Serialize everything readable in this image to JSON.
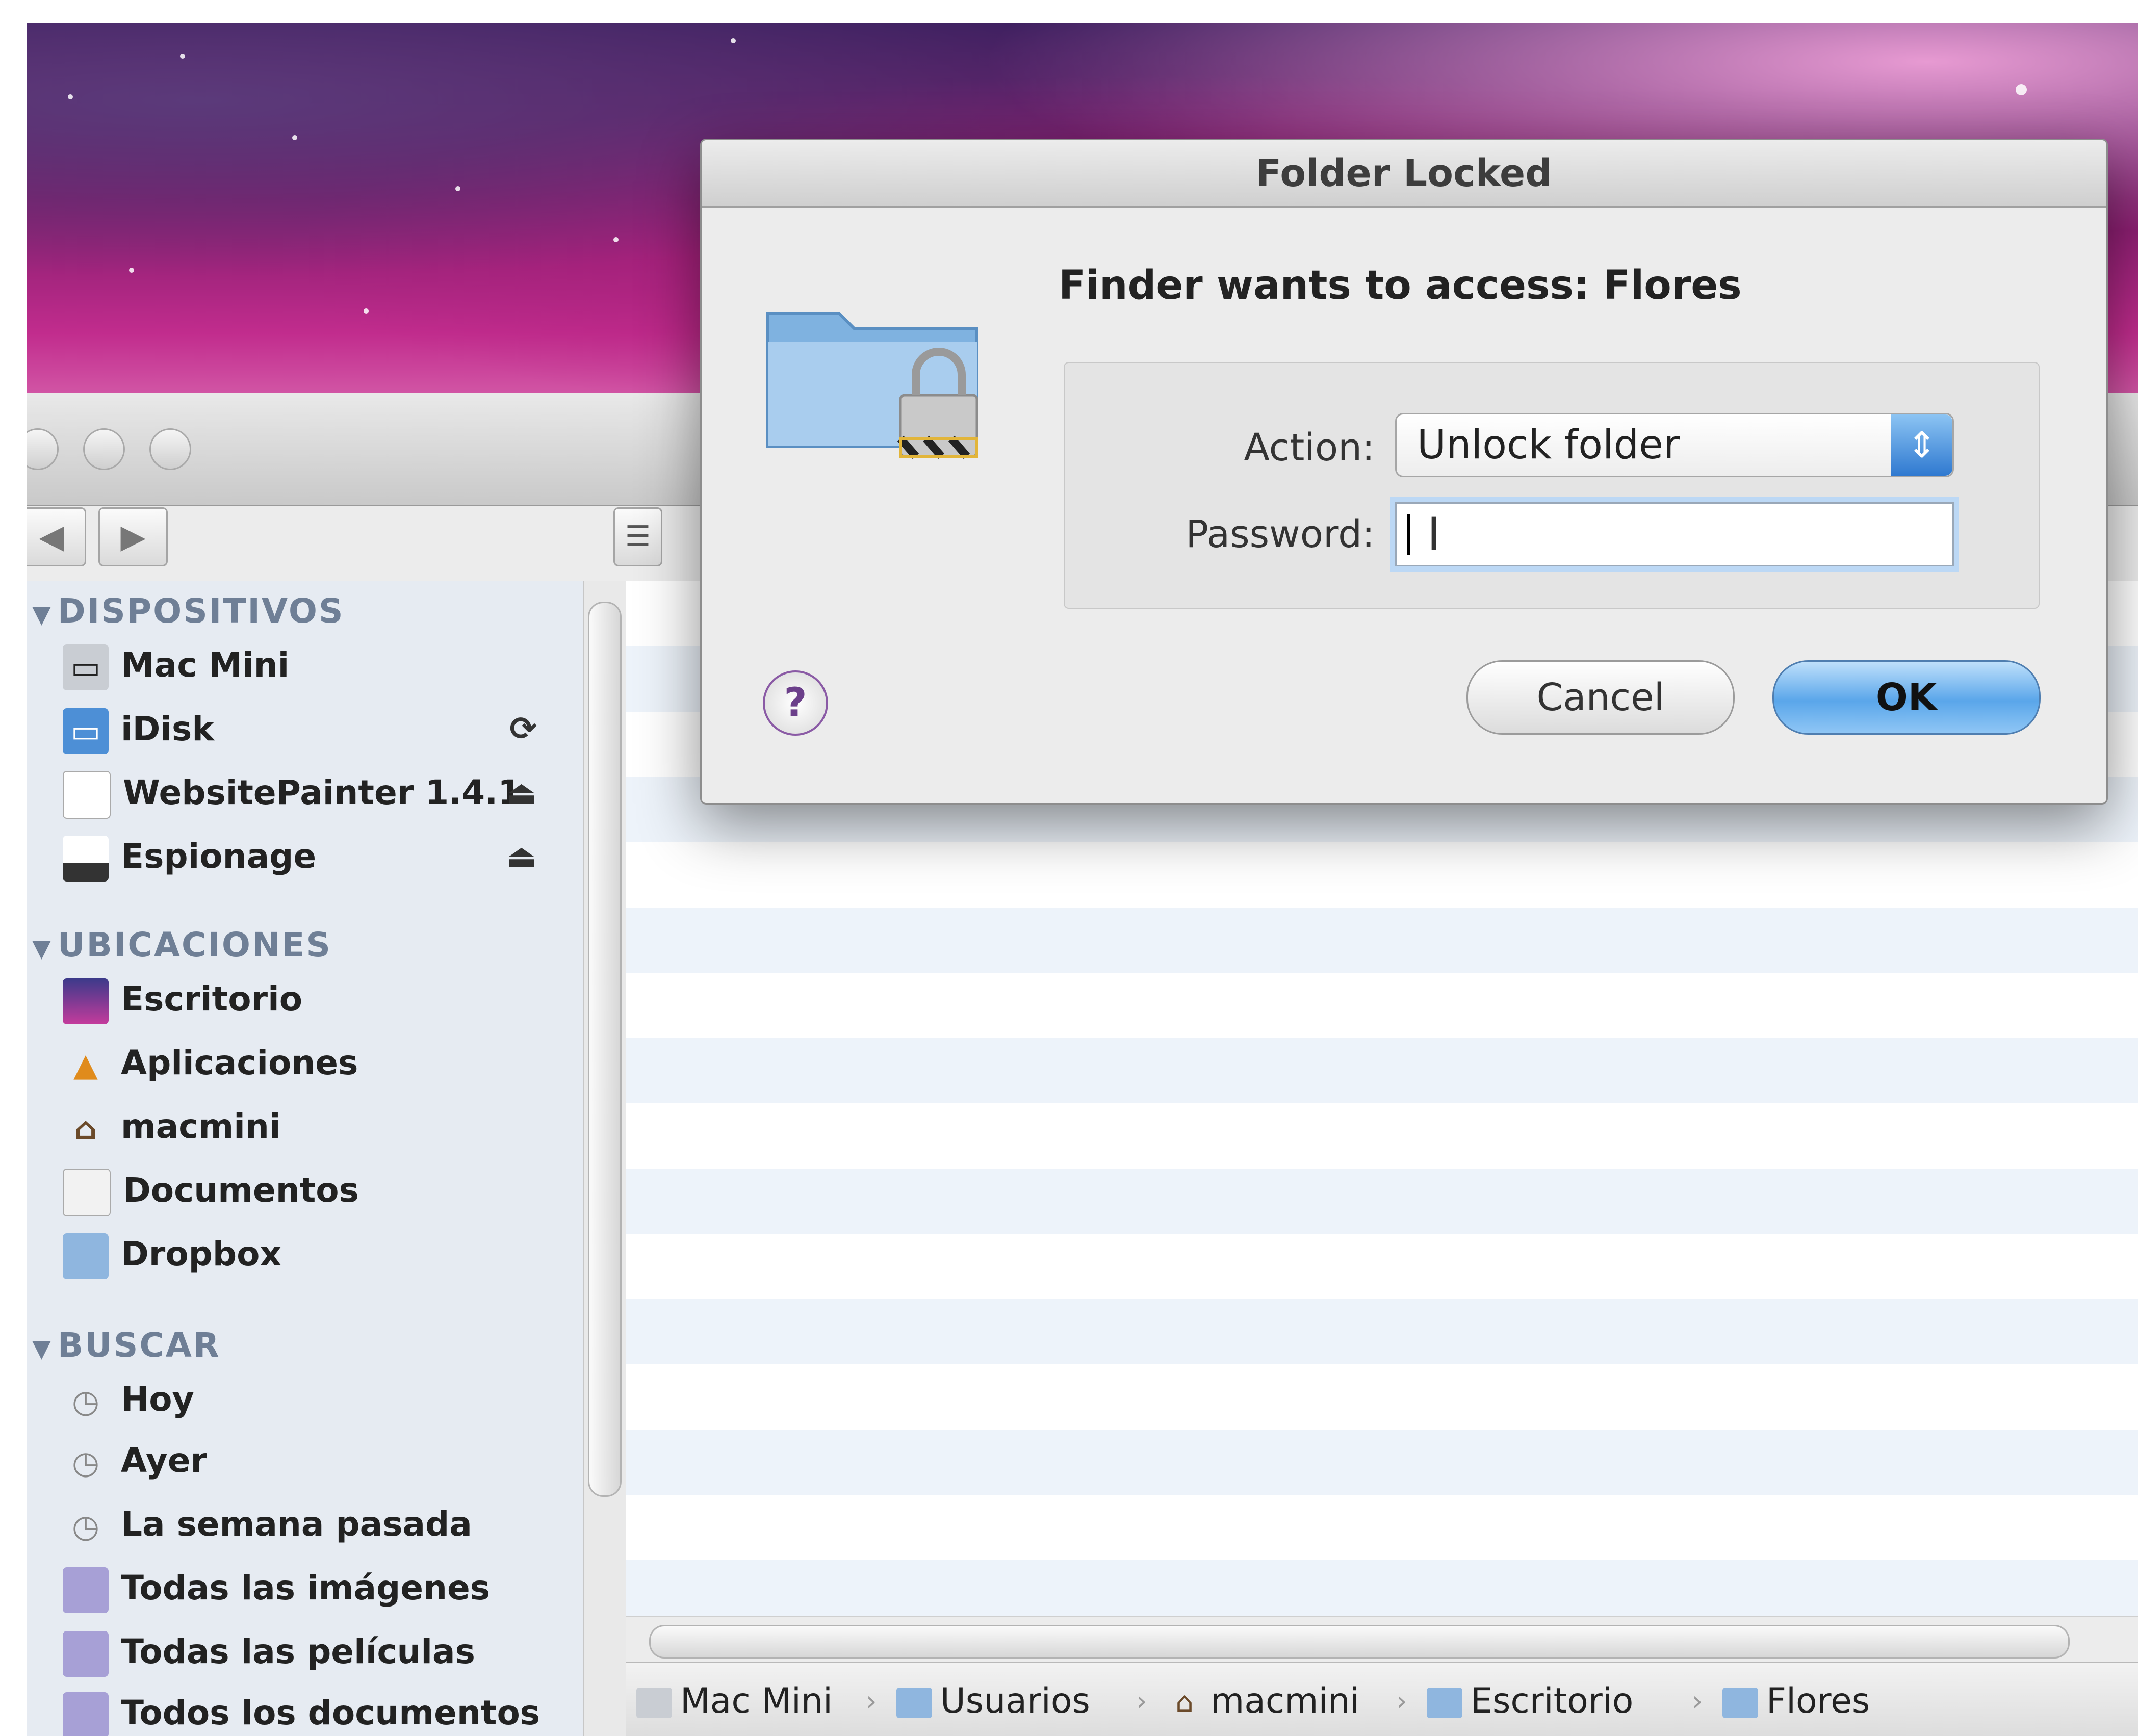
{
  "dialog": {
    "title": "Folder Locked",
    "heading": "Finder wants to access: Flores",
    "action_label": "Action:",
    "action_value": "Unlock folder",
    "password_label": "Password:",
    "password_value": "",
    "help_label": "?",
    "cancel_label": "Cancel",
    "ok_label": "OK",
    "icon": "locked-folder-icon"
  },
  "finder": {
    "nav": {
      "back_icon": "◀",
      "forward_icon": "▶"
    },
    "sidebar": {
      "sections": [
        {
          "title": "DISPOSITIVOS",
          "items": [
            {
              "label": "Mac Mini",
              "icon": "computer-icon"
            },
            {
              "label": "iDisk",
              "icon": "idisk-icon",
              "accessory": "sync-icon"
            },
            {
              "label": "WebsitePainter 1.4.1",
              "icon": "disk-image-icon",
              "accessory": "eject-icon"
            },
            {
              "label": "Espionage",
              "icon": "drive-icon",
              "accessory": "eject-icon"
            }
          ]
        },
        {
          "title": "UBICACIONES",
          "items": [
            {
              "label": "Escritorio",
              "icon": "desktop-icon"
            },
            {
              "label": "Aplicaciones",
              "icon": "applications-icon"
            },
            {
              "label": "macmini",
              "icon": "home-icon"
            },
            {
              "label": "Documentos",
              "icon": "documents-icon"
            },
            {
              "label": "Dropbox",
              "icon": "folder-icon"
            }
          ]
        },
        {
          "title": "BUSCAR",
          "items": [
            {
              "label": "Hoy",
              "icon": "clock-icon"
            },
            {
              "label": "Ayer",
              "icon": "clock-icon"
            },
            {
              "label": "La semana pasada",
              "icon": "clock-icon"
            },
            {
              "label": "Todas las imágenes",
              "icon": "smart-folder-icon"
            },
            {
              "label": "Todas las películas",
              "icon": "smart-folder-icon"
            },
            {
              "label": "Todos los documentos",
              "icon": "smart-folder-icon"
            }
          ]
        }
      ]
    },
    "path": [
      "Mac Mini",
      "Usuarios",
      "macmini",
      "Escritorio",
      "Flores"
    ]
  },
  "colors": {
    "accent": "#5aa6ea",
    "desktop": "#b01f7d"
  }
}
